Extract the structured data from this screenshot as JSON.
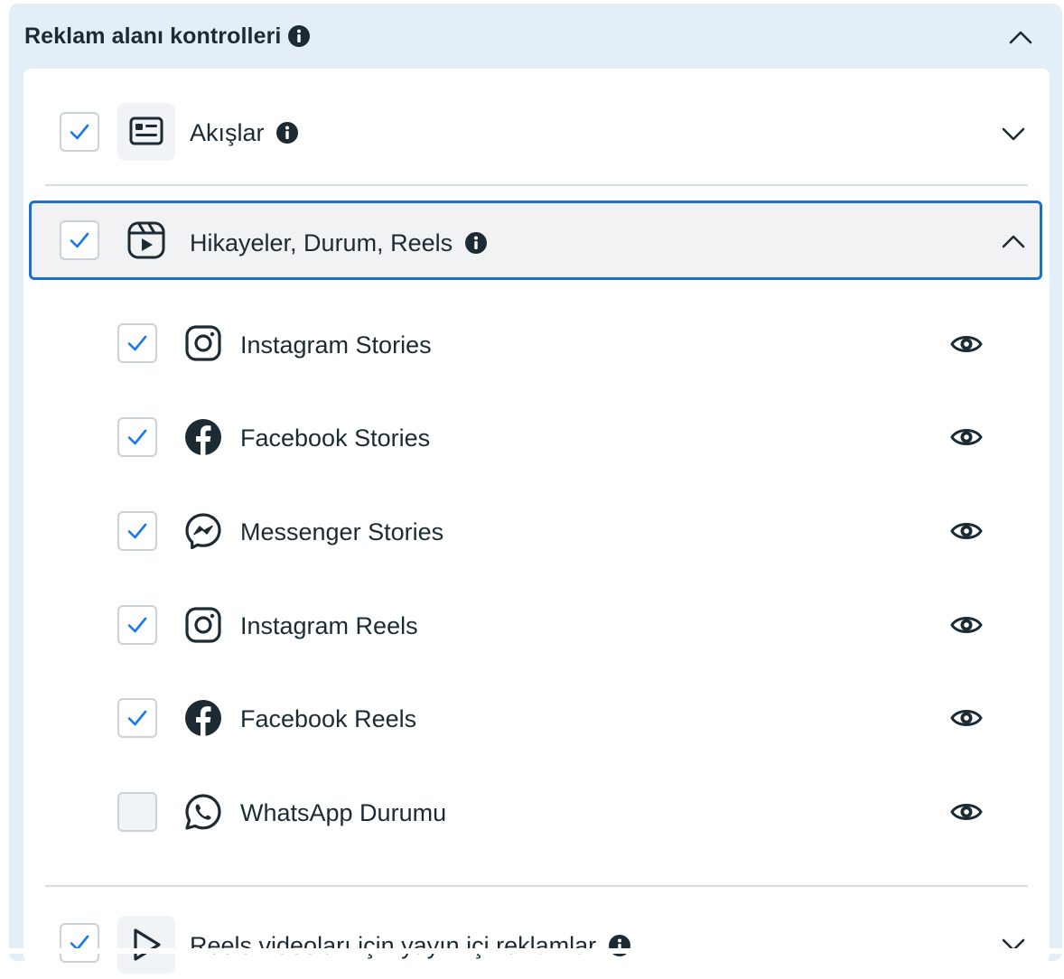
{
  "panel": {
    "title": "Reklam alanı kontrolleri"
  },
  "groups": [
    {
      "label": "Akışlar",
      "checked": true,
      "expanded": false
    },
    {
      "label": "Hikayeler, Durum, Reels",
      "checked": true,
      "expanded": true
    },
    {
      "label": "Reels videoları için yayın içi reklamlar",
      "checked": true,
      "expanded": false
    }
  ],
  "placements": [
    {
      "label": "Instagram Stories",
      "checked": true,
      "icon": "instagram-icon"
    },
    {
      "label": "Facebook Stories",
      "checked": true,
      "icon": "facebook-icon"
    },
    {
      "label": "Messenger Stories",
      "checked": true,
      "icon": "messenger-icon"
    },
    {
      "label": "Instagram Reels",
      "checked": true,
      "icon": "instagram-icon"
    },
    {
      "label": "Facebook Reels",
      "checked": true,
      "icon": "facebook-icon"
    },
    {
      "label": "WhatsApp Durumu",
      "checked": false,
      "icon": "whatsapp-icon"
    }
  ],
  "colors": {
    "panel_bg": "#e3eef8",
    "check": "#1877f2",
    "focus_border": "#1c6fd1",
    "text": "#1c2b33"
  }
}
